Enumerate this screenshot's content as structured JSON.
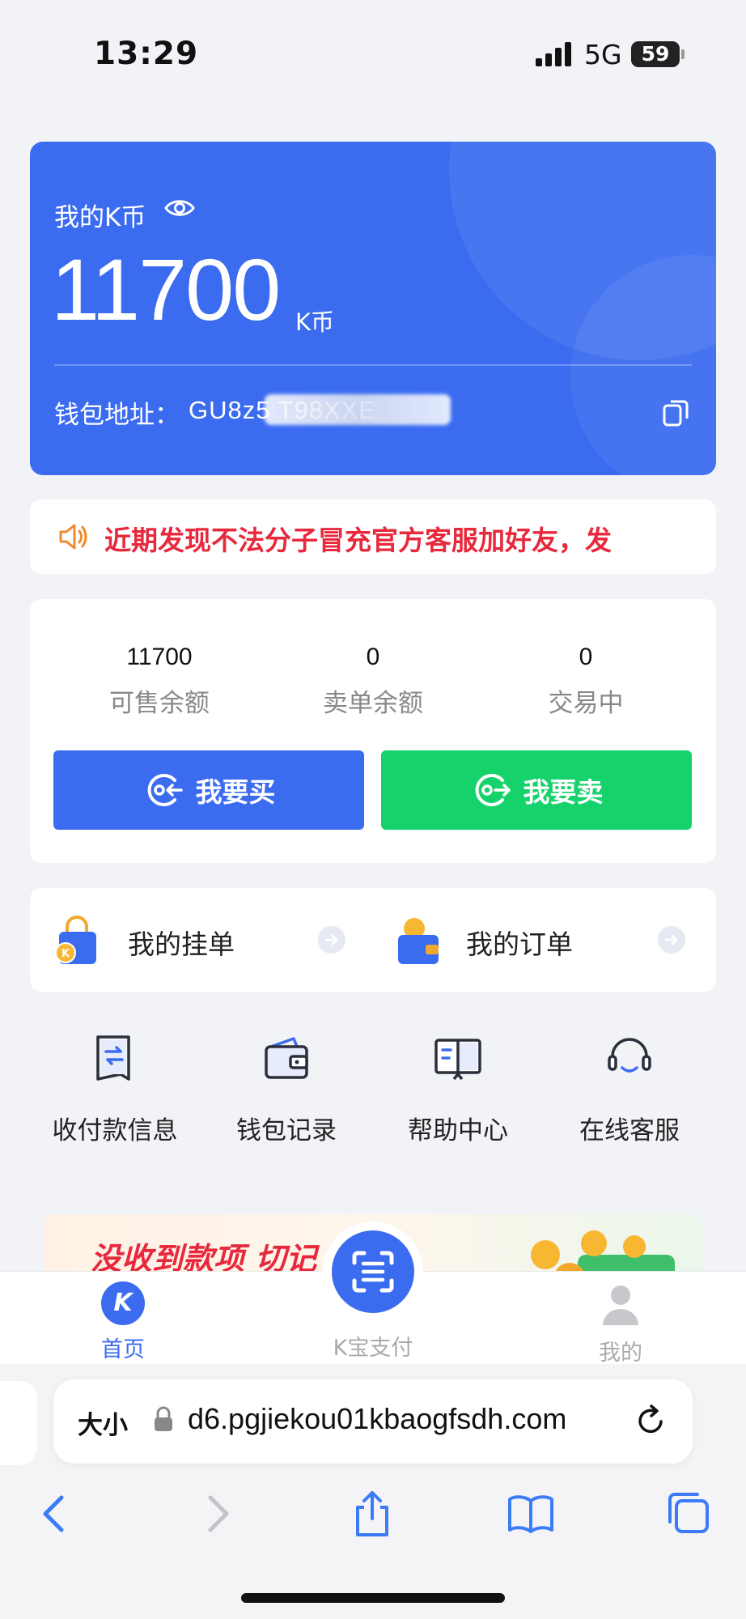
{
  "status_bar": {
    "time": "13:29",
    "network": "5G",
    "battery": "59"
  },
  "wallet": {
    "label": "我的K币",
    "balance": "11700",
    "unit": "K币",
    "address_label": "钱包地址：",
    "address_value": "GU8z5                    T98XXE"
  },
  "notice": {
    "text": "近期发现不法分子冒充官方客服加好友，发"
  },
  "stats": [
    {
      "value": "11700",
      "label": "可售余额"
    },
    {
      "value": "0",
      "label": "卖单余额"
    },
    {
      "value": "0",
      "label": "交易中"
    }
  ],
  "actions": {
    "buy": "我要买",
    "sell": "我要卖"
  },
  "orders": {
    "listings": "我的挂单",
    "my_orders": "我的订单"
  },
  "quick_menu": [
    {
      "label": "收付款信息",
      "icon": "payment-info-icon"
    },
    {
      "label": "钱包记录",
      "icon": "wallet-record-icon"
    },
    {
      "label": "帮助中心",
      "icon": "help-book-icon"
    },
    {
      "label": "在线客服",
      "icon": "headset-icon"
    }
  ],
  "banner": {
    "text": "没收到款项 切记            打币"
  },
  "tabbar": {
    "home": "首页",
    "pay": "K宝支付",
    "me": "我的",
    "home_icon_letter": "K"
  },
  "browser": {
    "text_size": "大小",
    "url": "d6.pgjiekou01kbaogfsdh.com"
  },
  "colors": {
    "primary": "#3b6cf0",
    "sell": "#16d26a",
    "alert": "#e8283c"
  }
}
